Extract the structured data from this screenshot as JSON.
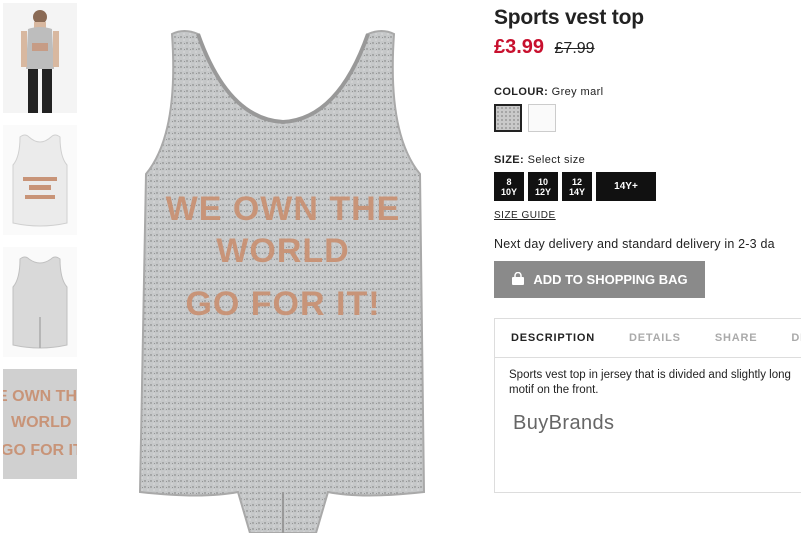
{
  "product": {
    "title": "Sports vest top",
    "price_now": "£3.99",
    "price_was": "£7.99",
    "print_lines": [
      "WE OWN THE",
      "WORLD",
      "GO FOR IT!"
    ]
  },
  "colour": {
    "label": "COLOUR:",
    "value": "Grey marl",
    "swatches": [
      "grey-marl-swatch",
      "white-swatch"
    ]
  },
  "size": {
    "label": "SIZE:",
    "value": "Select size",
    "options": [
      {
        "line1": "8",
        "line2": "10Y"
      },
      {
        "line1": "10",
        "line2": "12Y"
      },
      {
        "line1": "12",
        "line2": "14Y"
      },
      {
        "line1": "14Y+",
        "line2": ""
      }
    ],
    "guide": "SIZE GUIDE"
  },
  "delivery": "Next day delivery and standard delivery in 2-3 da",
  "bag_button": "ADD TO SHOPPING BAG",
  "tabs": [
    "DESCRIPTION",
    "DETAILS",
    "SHARE",
    "DE"
  ],
  "description": {
    "line1": "Sports vest top in jersey that is divided and slightly long",
    "line2": "motif on the front."
  },
  "watermark": "BuyBrands",
  "colors": {
    "sale": "#c8102e",
    "button": "#8a8a8a",
    "size_bg": "#111111",
    "print": "#c89478"
  }
}
